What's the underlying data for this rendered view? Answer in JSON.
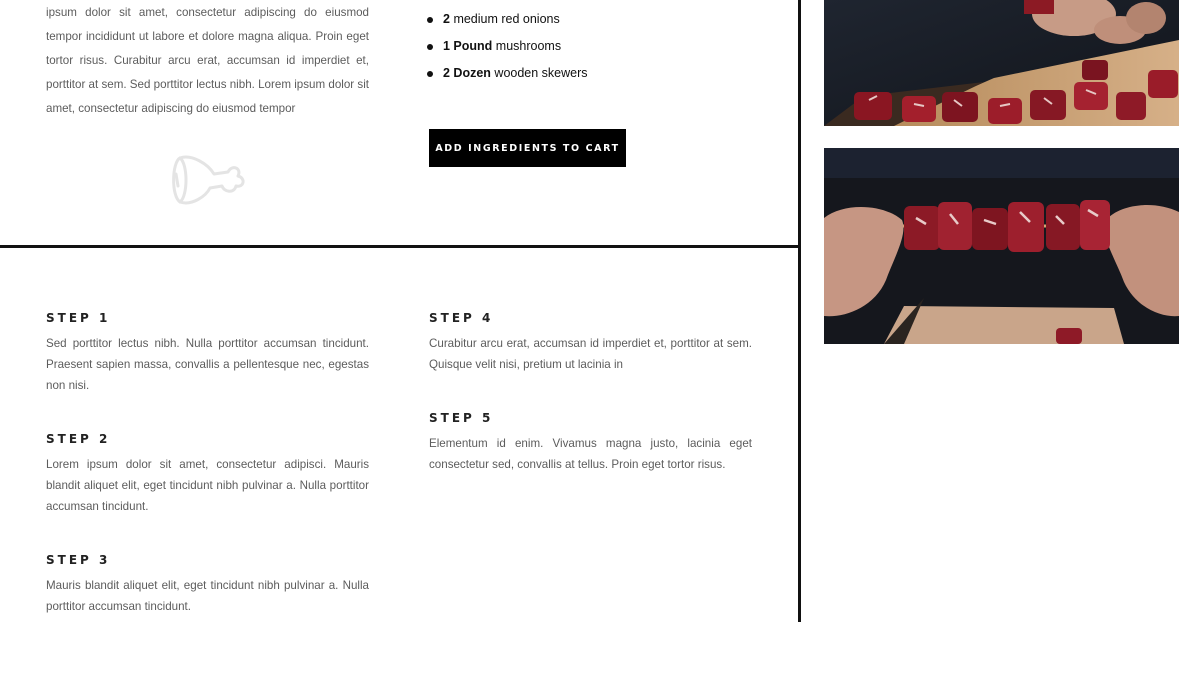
{
  "intro": {
    "text": "ipsum dolor sit amet, consectetur adipiscing do eiusmod tempor incididunt ut labore et dolore magna aliqua. Proin eget tortor risus. Curabitur arcu erat, accumsan id imperdiet et, porttitor at sem. Sed porttitor lectus nibh. Lorem ipsum dolor sit amet, consectetur adipiscing do eiusmod tempor"
  },
  "ingredients": [
    {
      "qty": "2",
      "item": "medium red onions"
    },
    {
      "qty": "1 Pound",
      "item": "mushrooms"
    },
    {
      "qty": "2 Dozen",
      "item": "wooden skewers"
    }
  ],
  "cart_button": {
    "label": "ADD INGREDIENTS TO CART"
  },
  "steps": [
    {
      "title": "STEP 1",
      "text": "Sed porttitor lectus nibh. Nulla porttitor accumsan tincidunt. Praesent sapien massa, convallis a pellentesque nec, egestas non nisi."
    },
    {
      "title": "STEP 2",
      "text": "Lorem ipsum dolor sit amet, consectetur adipisci. Mauris blandit aliquet elit, eget tincidunt nibh pulvinar a. Nulla porttitor accumsan tincidunt."
    },
    {
      "title": "STEP 3",
      "text": "Mauris blandit aliquet elit, eget tincidunt nibh pulvinar a. Nulla porttitor accumsan tincidunt."
    },
    {
      "title": "STEP 4",
      "text": "Curabitur arcu erat, accumsan id imperdiet et, porttitor at sem. Quisque velit nisi, pretium ut lacinia in"
    },
    {
      "title": "STEP 5",
      "text": "Elementum id enim. Vivamus magna justo, lacinia eget consectetur sed, convallis at tellus. Proin eget tortor risus."
    }
  ],
  "icons": {
    "decor": "meat-leg-icon"
  },
  "colors": {
    "button_bg": "#000000",
    "divider": "#111111",
    "text": "#5c5c5c"
  }
}
